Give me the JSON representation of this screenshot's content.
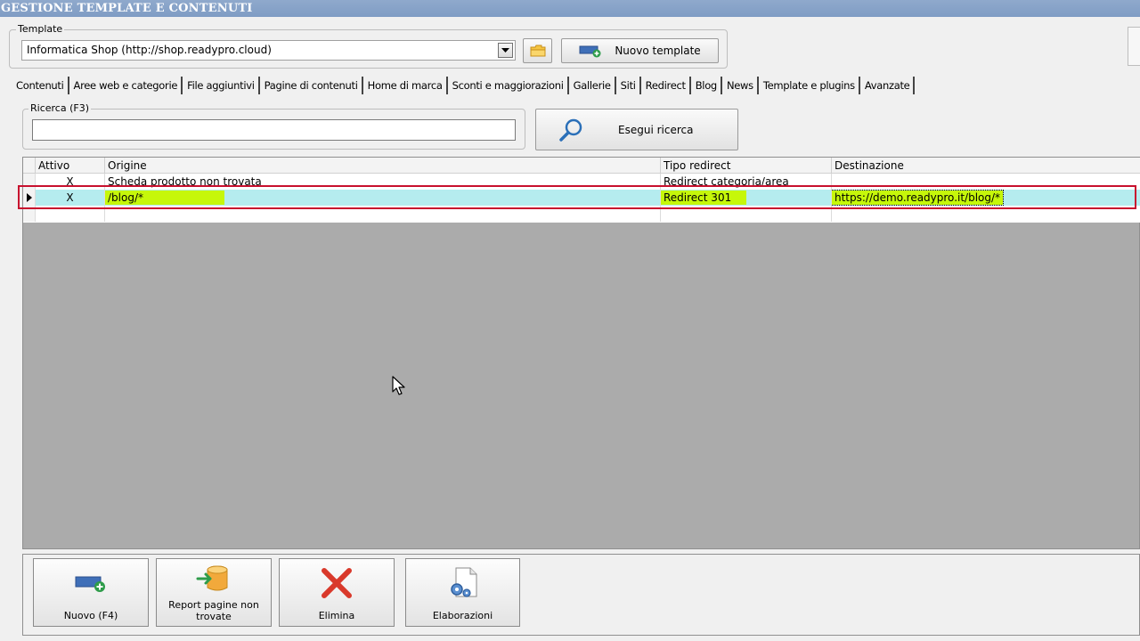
{
  "window": {
    "title": "GESTIONE TEMPLATE E CONTENUTI"
  },
  "template": {
    "label": "Template",
    "selected": "Informatica Shop (http://shop.readypro.cloud)",
    "new_button": "Nuovo template"
  },
  "tabs": [
    {
      "label": "Contenuti"
    },
    {
      "label": "Aree web e categorie"
    },
    {
      "label": "File aggiuntivi"
    },
    {
      "label": "Pagine di contenuti"
    },
    {
      "label": "Home di marca"
    },
    {
      "label": "Sconti e maggiorazioni"
    },
    {
      "label": "Gallerie"
    },
    {
      "label": "Siti"
    },
    {
      "label": "Redirect"
    },
    {
      "label": "Blog"
    },
    {
      "label": "News"
    },
    {
      "label": "Template e plugins"
    },
    {
      "label": "Avanzate"
    }
  ],
  "active_tab": "Redirect",
  "search": {
    "label": "Ricerca (F3)",
    "value": "",
    "button": "Esegui ricerca"
  },
  "grid": {
    "columns": [
      "Attivo",
      "Origine",
      "Tipo redirect",
      "Destinazione"
    ],
    "rows": [
      {
        "attivo": "X",
        "origine": "Scheda prodotto non trovata",
        "tipo": "Redirect categoria/area",
        "destinazione": ""
      },
      {
        "attivo": "X",
        "origine": "/blog/*",
        "tipo": "Redirect 301",
        "destinazione": "https://demo.readypro.it/blog/*"
      },
      {
        "attivo": "",
        "origine": "",
        "tipo": "",
        "destinazione": ""
      }
    ],
    "selected_row": 1
  },
  "actions": {
    "nuovo": "Nuovo (F4)",
    "report": "Report pagine non trovate",
    "elimina": "Elimina",
    "elaborazioni": "Elaborazioni"
  },
  "colors": {
    "titlebar": "#8fa9cc",
    "selected_row": "#b5ecef",
    "highlight": "#c6f70a",
    "redbox": "#c8102e"
  }
}
